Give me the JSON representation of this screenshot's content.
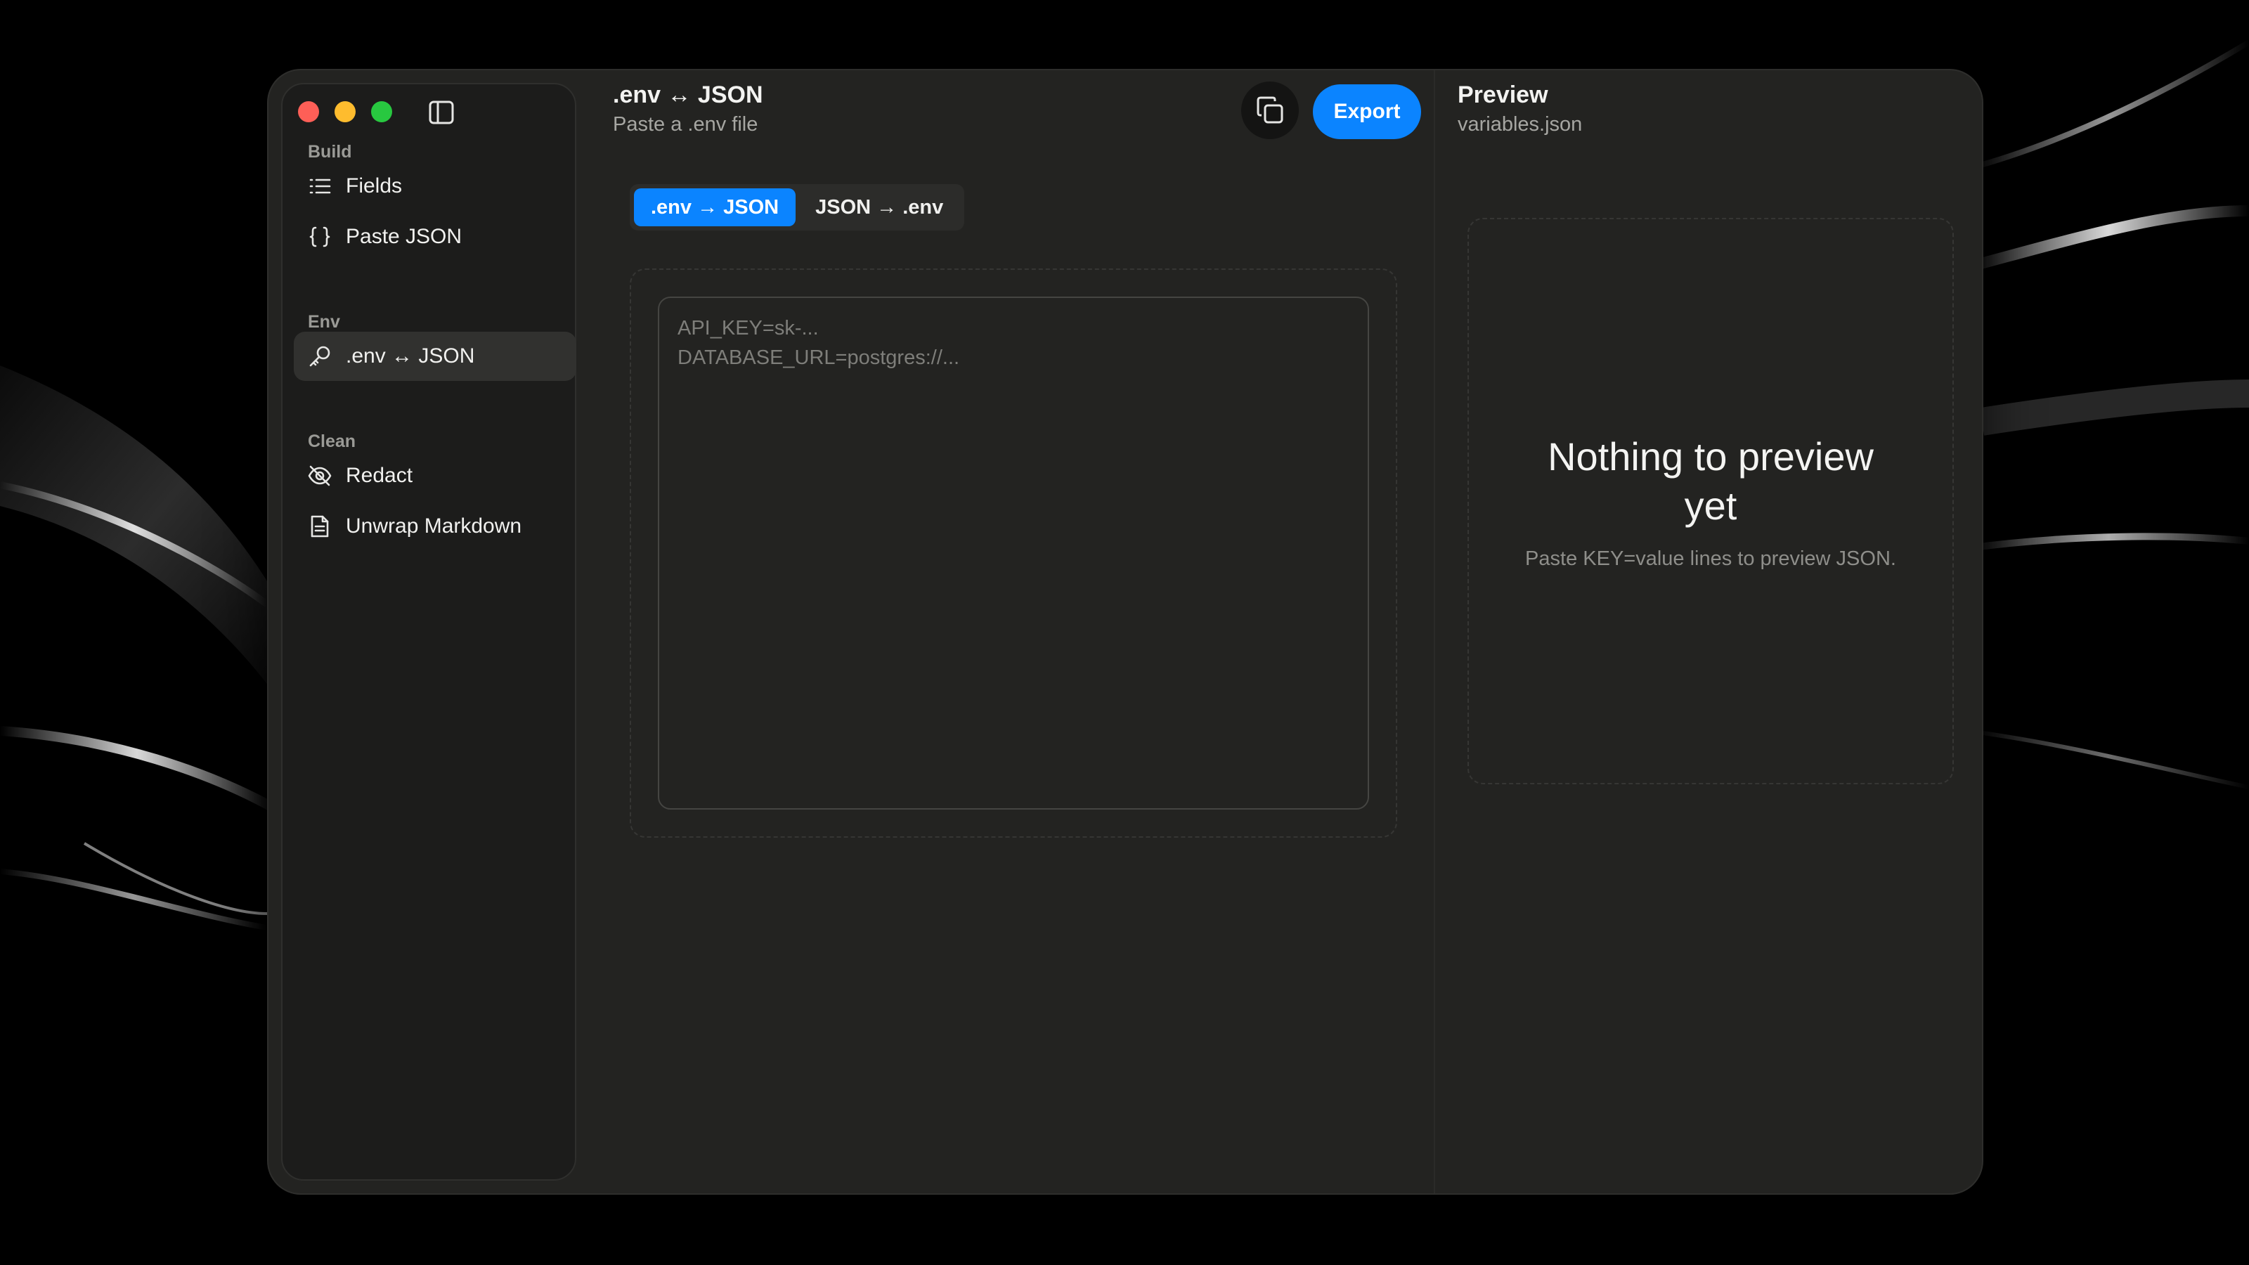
{
  "sidebar": {
    "sections": [
      {
        "label": "Build",
        "items": [
          {
            "label": "Fields",
            "icon": "list-icon"
          },
          {
            "label": "Paste JSON",
            "icon": "braces-icon"
          }
        ]
      },
      {
        "label": "Env",
        "items": [
          {
            "label": ".env ↔ JSON",
            "icon": "key-icon",
            "active": true
          }
        ]
      },
      {
        "label": "Clean",
        "items": [
          {
            "label": "Redact",
            "icon": "eye-off-icon"
          },
          {
            "label": "Unwrap Markdown",
            "icon": "document-icon"
          }
        ]
      }
    ]
  },
  "main": {
    "title": ".env ↔ JSON",
    "subtitle": "Paste a .env file",
    "export_label": "Export",
    "modes": [
      ".env → JSON",
      "JSON → .env"
    ],
    "active_mode": 0,
    "placeholder_lines": [
      "API_KEY=sk-...",
      "DATABASE_URL=postgres://..."
    ]
  },
  "preview": {
    "title": "Preview",
    "filename": "variables.json",
    "empty_title": "Nothing to preview yet",
    "empty_subtitle": "Paste KEY=value lines to preview JSON."
  },
  "colors": {
    "accent": "#0b84ff",
    "window_bg": "#232321",
    "sidebar_bg": "#1c1c1b"
  }
}
